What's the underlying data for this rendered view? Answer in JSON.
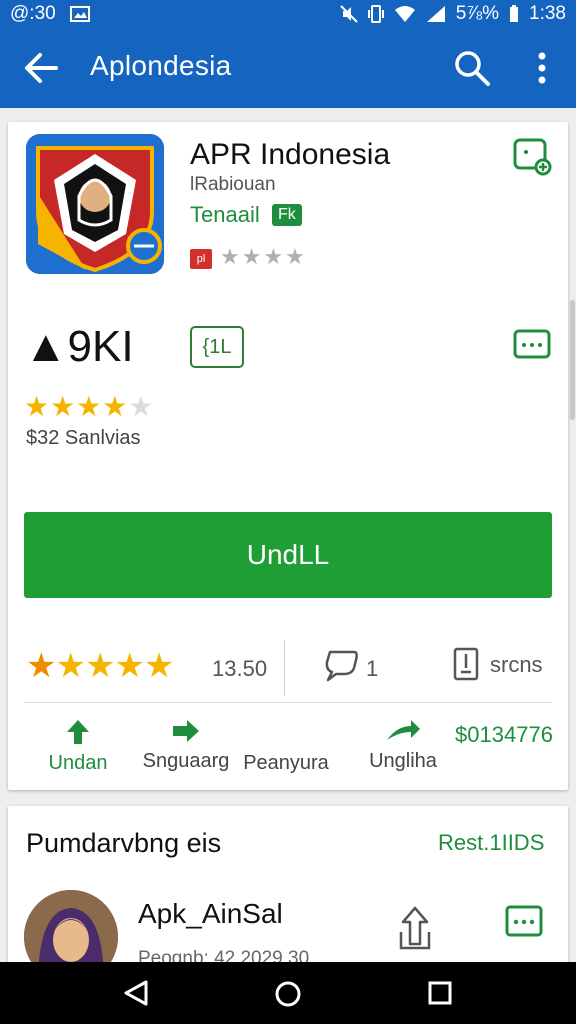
{
  "status_bar": {
    "left_text": "@:30",
    "battery": "5⅞%",
    "time": "1:38"
  },
  "app_bar": {
    "title": "Aplondesia",
    "back_icon": "arrow-left-icon",
    "search_icon": "search-icon",
    "more_icon": "more-vert-icon"
  },
  "app": {
    "name": "APR Indonesia",
    "developer": "lRabiouan",
    "category": "Tenaail",
    "category_badge": "Fk",
    "content_rating_badge": "pl",
    "big_rating": "▲9KI",
    "badge_box": "{1L",
    "rating_stars": 4,
    "price_text": "$32 Sanlvias",
    "install_label": "UndLL"
  },
  "stats": {
    "score": "13.50",
    "comments": "1",
    "doc_label": "srcns",
    "stars": 5
  },
  "actions": [
    {
      "label": "Undan",
      "icon": "arrow-up-icon",
      "color": "#1e8e3e"
    },
    {
      "label": "Snguaarg",
      "icon": "arrow-right-icon",
      "color": "#1e8e3e"
    },
    {
      "label": "Peanyura",
      "icon": "",
      "color": "#444444"
    },
    {
      "label": "Ungliha",
      "icon": "forward-arrow-icon",
      "color": "#1e8e3e"
    },
    {
      "label": "$0134776",
      "icon": "",
      "color": "#1e8e3e"
    }
  ],
  "reviews": {
    "title": "Pumdarvbng eis",
    "link": "Rest.1IIDS",
    "first": {
      "name": "Apk_AinSal",
      "meta": "Peognb: 42 2029 30"
    }
  },
  "colors": {
    "primary": "#1565c0",
    "green": "#1e9e35",
    "star": "#f5b400",
    "star_orange": "#f08a00"
  }
}
